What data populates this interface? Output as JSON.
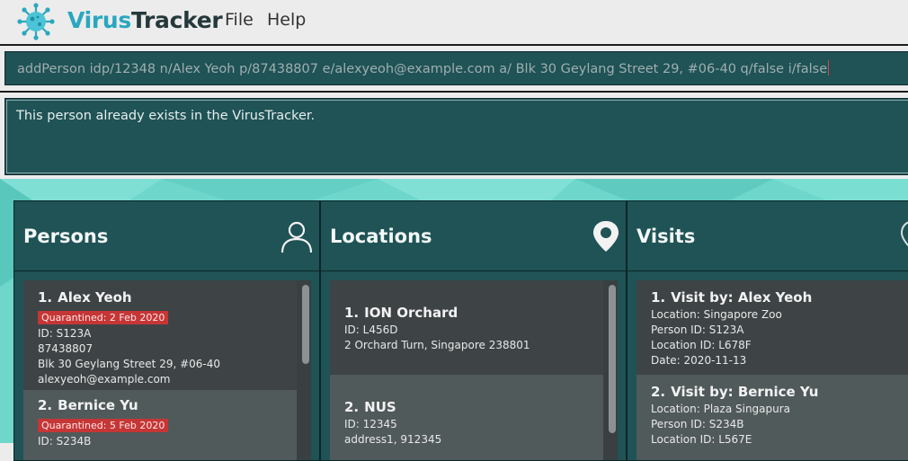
{
  "app": {
    "brand_virus": "Virus",
    "brand_tracker": "Tracker",
    "logo_icon": "virus-logo-icon"
  },
  "menu": {
    "file": "File",
    "help": "Help"
  },
  "command": {
    "value": "addPerson idp/12348 n/Alex Yeoh p/87438807 e/alexyeoh@example.com a/ Blk 30 Geylang Street 29, #06-40 q/false i/false"
  },
  "result": {
    "text": "This person already exists in the VirusTracker."
  },
  "panels": {
    "persons": {
      "title": "Persons",
      "icon": "person-icon"
    },
    "locations": {
      "title": "Locations",
      "icon": "map-pin-icon"
    },
    "visits": {
      "title": "Visits",
      "icon": "map-pin-icon"
    }
  },
  "persons": [
    {
      "num": "1.",
      "name": "Alex Yeoh",
      "badge": "Quarantined: 2 Feb 2020",
      "id": "ID: S123A",
      "phone": "87438807",
      "address": "Blk 30 Geylang Street 29, #06-40",
      "email": "alexyeoh@example.com"
    },
    {
      "num": "2.",
      "name": "Bernice Yu",
      "badge": "Quarantined: 5 Feb 2020",
      "id": "ID: S234B"
    }
  ],
  "locations": [
    {
      "num": "1.",
      "name": "ION Orchard",
      "id": "ID: L456D",
      "address": "2 Orchard Turn, Singapore 238801"
    },
    {
      "num": "2.",
      "name": "NUS",
      "id": "ID: 12345",
      "address": "address1, 912345"
    }
  ],
  "visits": [
    {
      "num": "1.",
      "title": "Visit by: Alex Yeoh",
      "location": "Location: Singapore Zoo",
      "person_id": "Person ID: S123A",
      "location_id": "Location ID: L678F",
      "date": "Date: 2020-11-13"
    },
    {
      "num": "2.",
      "title": "Visit by: Bernice Yu",
      "location": "Location: Plaza Singapura",
      "person_id": "Person ID: S234B",
      "location_id": "Location ID: L567E"
    }
  ],
  "colors": {
    "brand_accent": "#2aa7bf",
    "panel_bg": "#1f5356",
    "badge_red": "#c53636",
    "background_teal": "#6fd6cc"
  }
}
